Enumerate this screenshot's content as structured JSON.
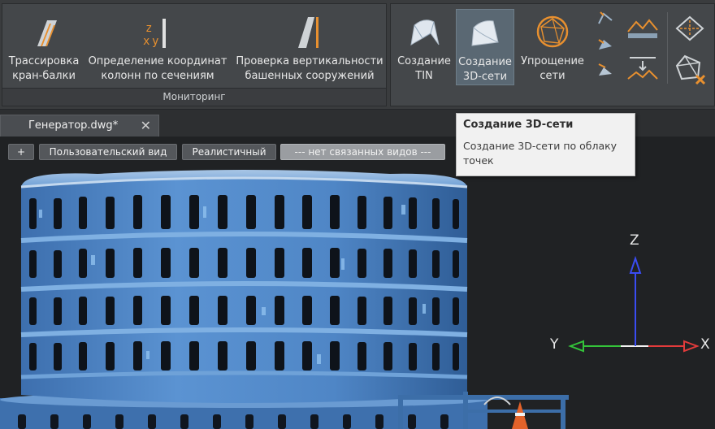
{
  "ribbon": {
    "monitoring": {
      "panel_title": "Мониторинг",
      "buttons": [
        {
          "line1": "Трассировка",
          "line2": "кран-балки"
        },
        {
          "line1": "Определение координат",
          "line2": "колонн по сечениям"
        },
        {
          "line1": "Проверка вертикальности",
          "line2": "башенных сооружений"
        }
      ],
      "zxy_icon_letters": {
        "z": "z",
        "x": "x",
        "y": "y"
      }
    },
    "surfaces": {
      "buttons": [
        {
          "line1": "Создание",
          "line2": "TIN"
        },
        {
          "line1": "Создание",
          "line2": "3D-сети"
        },
        {
          "line1": "Упрощение",
          "line2": "сети"
        }
      ]
    }
  },
  "document_tab": {
    "label": "Генератор.dwg*",
    "close_glyph": "✕"
  },
  "viewport_toolbar": {
    "plus": "+",
    "view": "Пользовательский вид",
    "visual_style": "Реалистичный",
    "linked_views": "--- нет связанных видов ---"
  },
  "tooltip": {
    "title": "Создание 3D-сети",
    "description": "Создание 3D-сети по облаку точек"
  },
  "axes": {
    "x": "X",
    "y": "Y",
    "z": "Z"
  },
  "colors": {
    "ribbon_bg": "#3a3c3e",
    "panel_bg": "#44474a",
    "active_button": "#5a6873",
    "viewport_bg": "#202224",
    "axis_x": "#e23b3b",
    "axis_y": "#34c43a",
    "axis_z": "#3a4cf2",
    "model_blue": "#4f86c6",
    "accent_orange": "#e8902f"
  }
}
